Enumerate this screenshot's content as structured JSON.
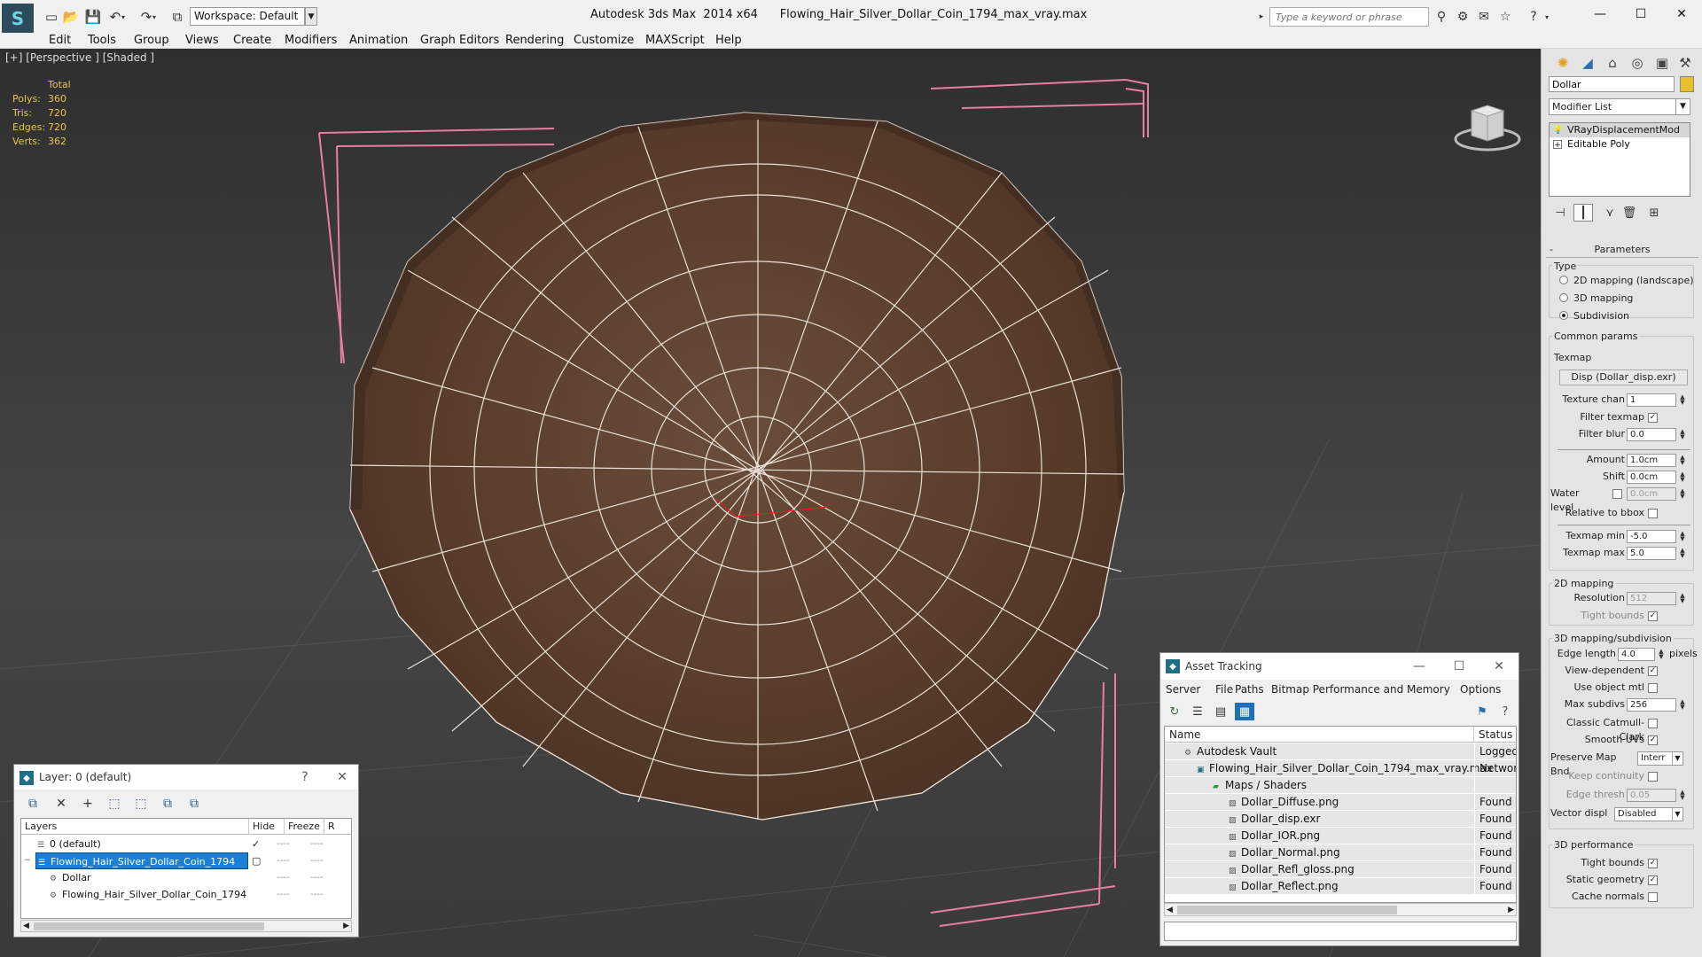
{
  "titlebar": {
    "workspace": "Workspace: Default",
    "app_title": "Autodesk 3ds Max  2014 x64",
    "file_name": "Flowing_Hair_Silver_Dollar_Coin_1794_max_vray.max",
    "search_placeholder": "Type a keyword or phrase"
  },
  "menu": [
    "Edit",
    "Tools",
    "Group",
    "Views",
    "Create",
    "Modifiers",
    "Animation",
    "Graph Editors",
    "Rendering",
    "Customize",
    "MAXScript",
    "Help"
  ],
  "viewport": {
    "label": "[+] [Perspective ] [Shaded ]",
    "stats": {
      "header": "Total",
      "rows": [
        {
          "label": "Polys:",
          "value": "360"
        },
        {
          "label": "Tris:",
          "value": "720"
        },
        {
          "label": "Edges:",
          "value": "720"
        },
        {
          "label": "Verts:",
          "value": "362"
        }
      ]
    }
  },
  "command_panel": {
    "object_name": "Dollar",
    "object_color": "#e6c02a",
    "modifier_list": "Modifier List",
    "stack": [
      "VRayDisplacementMod",
      "Editable Poly"
    ],
    "rollout": "Parameters",
    "type_group": "Type",
    "types": [
      "2D mapping (landscape)",
      "3D mapping",
      "Subdivision"
    ],
    "common_group": "Common params",
    "texmap_label": "Texmap",
    "texmap_button": "Disp (Dollar_disp.exr)",
    "texture_chan": {
      "label": "Texture chan",
      "value": "1"
    },
    "filter_texmap": "Filter texmap",
    "filter_blur": {
      "label": "Filter blur",
      "value": "0.0"
    },
    "amount": {
      "label": "Amount",
      "value": "1.0cm"
    },
    "shift": {
      "label": "Shift",
      "value": "0.0cm"
    },
    "water_level": {
      "label": "Water level",
      "value": "0.0cm"
    },
    "relative_bbox": "Relative to bbox",
    "texmap_min": {
      "label": "Texmap min",
      "value": "-5.0"
    },
    "texmap_max": {
      "label": "Texmap max",
      "value": "5.0"
    },
    "mapping2d_group": "2D mapping",
    "resolution": {
      "label": "Resolution",
      "value": "512"
    },
    "tight_bounds": "Tight bounds",
    "mapping3d_group": "3D mapping/subdivision",
    "edge_length": {
      "label": "Edge length",
      "value": "4.0",
      "unit": "pixels"
    },
    "view_dependent": "View-dependent",
    "use_object_mtl": "Use object mtl",
    "max_subdivs": {
      "label": "Max subdivs",
      "value": "256"
    },
    "classic_catmull": "Classic Catmull-Clark",
    "smooth_uvs": "Smooth UVs",
    "preserve_map_bnd": {
      "label": "Preserve Map Bnd",
      "value": "Interr"
    },
    "keep_continuity": "Keep continuity",
    "edge_thresh": {
      "label": "Edge thresh",
      "value": "0.05"
    },
    "vector_displ": {
      "label": "Vector displ",
      "value": "Disabled"
    },
    "performance_group": "3D performance",
    "perf_tight_bounds": "Tight bounds",
    "static_geometry": "Static geometry",
    "cache_normals": "Cache normals"
  },
  "layer_dialog": {
    "title": "Layer: 0 (default)",
    "help": "?",
    "columns": [
      "Layers",
      "Hide",
      "Freeze",
      "R"
    ],
    "rows": [
      "0 (default)",
      "Flowing_Hair_Silver_Dollar_Coin_1794",
      "Dollar",
      "Flowing_Hair_Silver_Dollar_Coin_1794"
    ],
    "hide_mark": "----"
  },
  "asset_tracking": {
    "title": "Asset Tracking",
    "menu": [
      "Server",
      "File",
      "Paths",
      "Bitmap Performance and Memory",
      "Options"
    ],
    "columns": [
      "Name",
      "Status"
    ],
    "rows": [
      {
        "name": "Autodesk Vault",
        "status": "Logged O"
      },
      {
        "name": "Flowing_Hair_Silver_Dollar_Coin_1794_max_vray.max",
        "status": "Network"
      },
      {
        "name": "Maps / Shaders",
        "status": ""
      },
      {
        "name": "Dollar_Diffuse.png",
        "status": "Found"
      },
      {
        "name": "Dollar_disp.exr",
        "status": "Found"
      },
      {
        "name": "Dollar_IOR.png",
        "status": "Found"
      },
      {
        "name": "Dollar_Normal.png",
        "status": "Found"
      },
      {
        "name": "Dollar_Refl_gloss.png",
        "status": "Found"
      },
      {
        "name": "Dollar_Reflect.png",
        "status": "Found"
      }
    ]
  }
}
